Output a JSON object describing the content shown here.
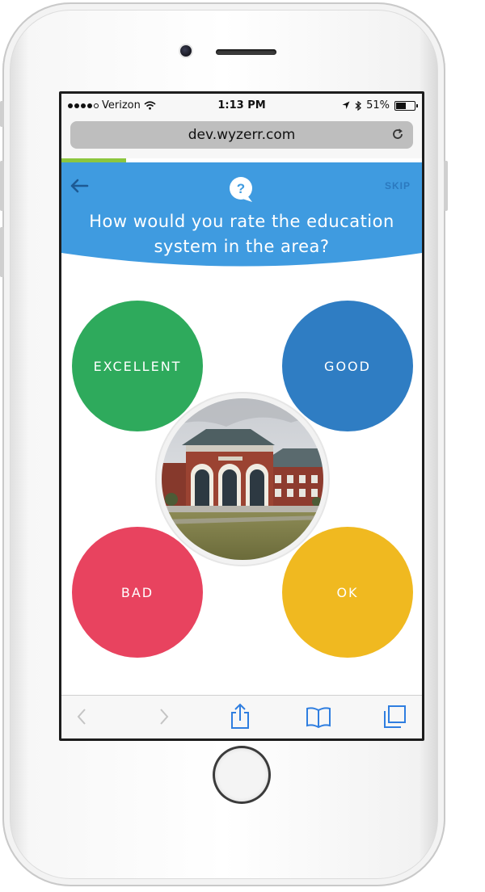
{
  "status_bar": {
    "carrier": "Verizon",
    "time": "1:13 PM",
    "battery": "51%"
  },
  "browser": {
    "url": "dev.wyzerr.com"
  },
  "survey": {
    "progress_fraction": 0.18,
    "skip_label": "SKIP",
    "question": "How would you rate the education system in the area?",
    "options": [
      {
        "label": "EXCELLENT",
        "color": "#2eaa5c"
      },
      {
        "label": "GOOD",
        "color": "#2f7dc3"
      },
      {
        "label": "BAD",
        "color": "#e8435f"
      },
      {
        "label": "OK",
        "color": "#f0b920"
      }
    ],
    "header_color": "#3f9be0",
    "icons": [
      "back-arrow-icon",
      "question-bubble-icon"
    ]
  },
  "toolbar": {
    "icons": [
      "back-icon",
      "forward-icon",
      "share-icon",
      "bookmarks-icon",
      "tabs-icon"
    ]
  }
}
